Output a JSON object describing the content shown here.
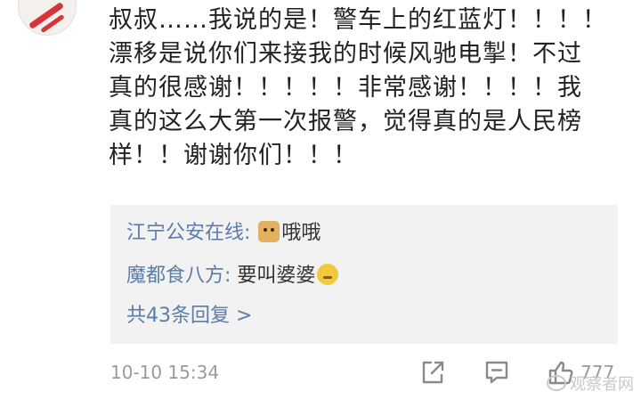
{
  "comment": {
    "lines": [
      "叔叔……我说的是！警车上的红蓝灯！！！！",
      "漂移是说你们来接我的时候风驰电掣！不过",
      "真的很感谢！！！！！非常感谢！！！！我",
      "真的这么大第一次报警，觉得真的是人民榜",
      "样！！谢谢你们！！！"
    ]
  },
  "replies": [
    {
      "author": "江宁公安在线:",
      "emoji": "doge-icon",
      "text": "哦哦",
      "emoji_after": false
    },
    {
      "author": "魔都食八方:",
      "emoji": "thinking-icon",
      "text": "要叫婆婆",
      "emoji_after": true
    }
  ],
  "more_replies": "共43条回复 >",
  "footer": {
    "timestamp": "10-10 15:34",
    "like_count": "777"
  },
  "watermark": "观察者网",
  "colors": {
    "link": "#5b7da8",
    "reply_bg": "#f2f2f2",
    "meta": "#9a9a9a"
  }
}
